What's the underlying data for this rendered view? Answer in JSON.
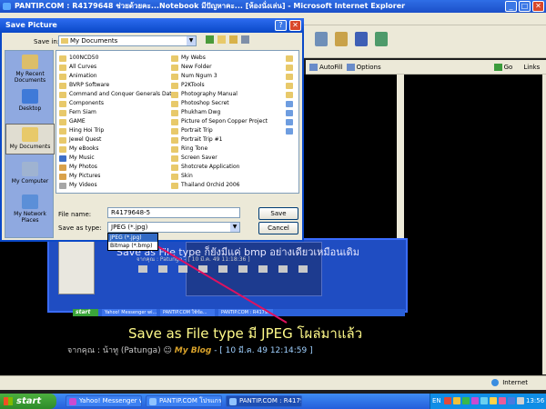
{
  "ie": {
    "title": "PANTIP.COM : R4179648 ช่วยด้วยคะ...Notebook มีปัญหาคะ... [ห้องนั่งเล่น] - Microsoft Internet Explorer",
    "links": [
      "AutoFill",
      "Options",
      "Go",
      "Links"
    ],
    "status_zone": "Internet"
  },
  "dialog": {
    "title": "Save Picture",
    "save_in_label": "Save in:",
    "save_in_value": "My Documents",
    "places": [
      "My Recent Documents",
      "Desktop",
      "My Documents",
      "My Computer",
      "My Network Places"
    ],
    "files_col1": [
      {
        "name": "100NCD50",
        "type": "folder"
      },
      {
        "name": "All Curves",
        "type": "folder"
      },
      {
        "name": "Animation",
        "type": "folder"
      },
      {
        "name": "BVRP Software",
        "type": "folder"
      },
      {
        "name": "Command and Conquer Generals Data",
        "type": "folder"
      },
      {
        "name": "Components",
        "type": "folder"
      },
      {
        "name": "Fern Siam",
        "type": "folder"
      },
      {
        "name": "GAME",
        "type": "folder"
      },
      {
        "name": "Hing Hoi Trip",
        "type": "folder"
      },
      {
        "name": "Jewel Quest",
        "type": "folder"
      },
      {
        "name": "My eBooks",
        "type": "folder"
      },
      {
        "name": "My Music",
        "type": "music"
      },
      {
        "name": "My Photos",
        "type": "pict"
      },
      {
        "name": "My Pictures",
        "type": "pict"
      },
      {
        "name": "My Videos",
        "type": "vid"
      }
    ],
    "files_col2": [
      {
        "name": "My Webs",
        "type": "folder"
      },
      {
        "name": "New Folder",
        "type": "folder"
      },
      {
        "name": "Num Ngum 3",
        "type": "folder"
      },
      {
        "name": "P2KTools",
        "type": "folder"
      },
      {
        "name": "Photography Manual",
        "type": "folder"
      },
      {
        "name": "Photoshop Secret",
        "type": "folder"
      },
      {
        "name": "Phukham Dwg",
        "type": "folder"
      },
      {
        "name": "Picture of Sepon Copper Project",
        "type": "folder"
      },
      {
        "name": "Portrait Trip",
        "type": "folder"
      },
      {
        "name": "Portrait Trip #1",
        "type": "folder"
      },
      {
        "name": "Ring Tone",
        "type": "folder"
      },
      {
        "name": "Screen Saver",
        "type": "folder"
      },
      {
        "name": "Shotcrete Application",
        "type": "folder"
      },
      {
        "name": "Skin",
        "type": "folder"
      },
      {
        "name": "Thailand Orchid 2006",
        "type": "folder"
      }
    ],
    "file_name_label": "File name:",
    "file_name_value": "R4179648-5",
    "save_type_label": "Save as type:",
    "save_type_value": "JPEG (*.jpg)",
    "type_options": [
      "JPEG (*.jpg)",
      "Bitmap (*.bmp)"
    ],
    "save_button": "Save",
    "cancel_button": "Cancel"
  },
  "page": {
    "inner_caption": "Save as File type ก็ยังมีแค่ bmp อย่างเดียวเหมือนเดิม",
    "inner_sub": "จากคุณ : Patunga  -  [ 10 มี.ค. 49 11:18:36 ]",
    "caption": "Save as File type มี JPEG โผล่มาแล้ว",
    "byline_prefix": "จากคุณ : น้าทู (Patunga)",
    "byline_blog": "My Blog",
    "byline_date": "- [ 10 มี.ค. 49 12:14:59 ]",
    "inner_start": "start",
    "inner_tasks": [
      "Yahoo! Messenger wi...",
      "PANTIP.COM ใช้ข้อ...",
      "PANTIP.COM : R4179..."
    ]
  },
  "taskbar": {
    "start": "start",
    "tasks": [
      "Yahoo! Messenger wi...",
      "PANTIP.COM โปรแกรม...",
      "PANTIP.COM : R4179..."
    ],
    "lang": "EN",
    "clock": "13:56"
  }
}
